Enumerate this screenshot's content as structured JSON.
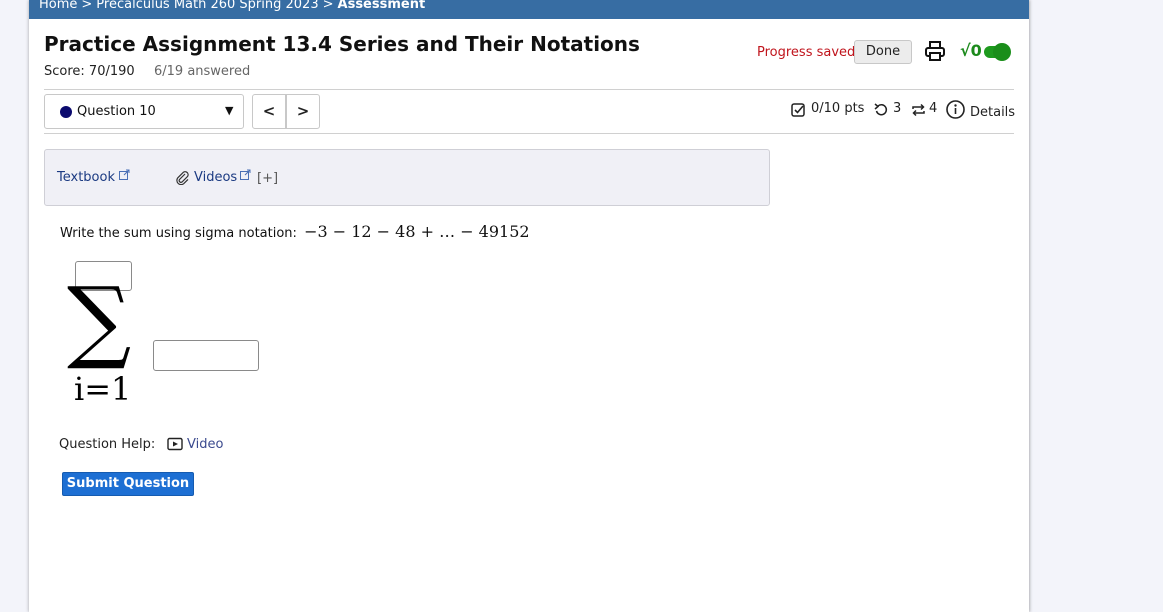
{
  "breadcrumb": {
    "items": [
      "Home",
      "Precalculus Math 260 Spring 2023"
    ],
    "current": "Assessment",
    "separator": ">"
  },
  "assignment": {
    "title": "Practice Assignment 13.4 Series and Their Notations",
    "score": "Score: 70/190",
    "answered": "6/19 answered"
  },
  "header_actions": {
    "progress_status": "Progress saved",
    "done_label": "Done",
    "math_toggle_label": "√0",
    "print_icon": "printer-icon",
    "math_toggle_on": true
  },
  "question_nav": {
    "selected_question": "Question 10",
    "status_color": "#0b0a6e",
    "prev_symbol": "<",
    "next_symbol": ">"
  },
  "question_stats": {
    "points": "0/10 pts",
    "retries": "3",
    "attempts": "4",
    "details_label": "Details"
  },
  "resources": {
    "textbook_label": "Textbook",
    "videos_label": "Videos",
    "expand_label": "[+]"
  },
  "question": {
    "prompt": "Write the sum using sigma notation:",
    "expression": "−3 − 12 − 48 + … − 49152",
    "sigma_lower": "i=1",
    "upper_value": "",
    "term_value": ""
  },
  "help": {
    "label": "Question Help:",
    "video_label": "Video"
  },
  "submit_label": "Submit Question",
  "colors": {
    "topbar": "#376da3",
    "progress_text": "#c0141c",
    "toggle": "#1e9a1e",
    "submit": "#1d6fd3",
    "link": "#1b3a82"
  }
}
